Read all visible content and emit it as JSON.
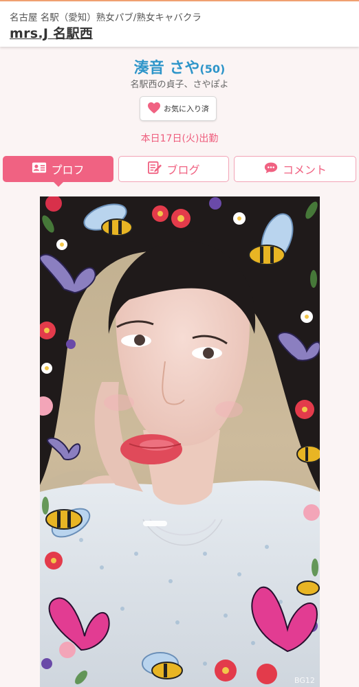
{
  "header": {
    "area": "名古屋 名駅（愛知）熟女パブ/熟女キャバクラ",
    "shop_name": "mrs.J 名駅西"
  },
  "profile": {
    "name": "湊音 さや",
    "age": "(50)",
    "catch_copy": "名駅西の貞子、さやぽよ",
    "favorite_label": "お気に入り済",
    "schedule": "本日17日(火)出勤"
  },
  "tabs": [
    {
      "label": "プロフ",
      "icon": "profile-card-icon",
      "active": true
    },
    {
      "label": "ブログ",
      "icon": "blog-edit-icon",
      "active": false
    },
    {
      "label": "コメント",
      "icon": "comment-bubble-icon",
      "active": false
    }
  ],
  "photo": {
    "watermark": "BG12"
  },
  "colors": {
    "accent": "#f06282",
    "name_blue": "#2e95c9",
    "schedule_pink": "#ee5c7c",
    "header_border": "#f0a070"
  }
}
